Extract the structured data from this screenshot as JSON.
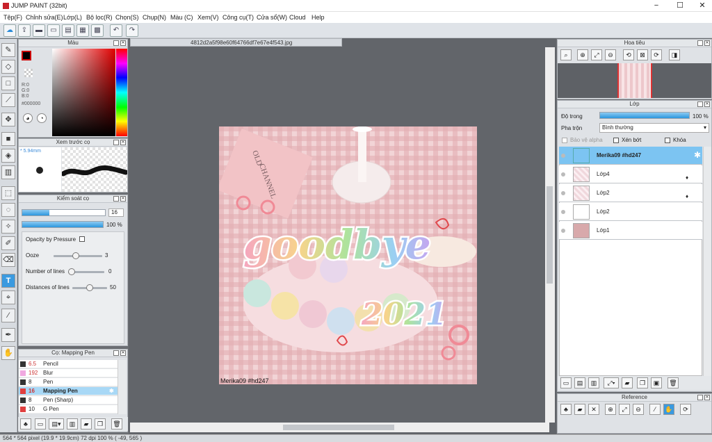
{
  "app": {
    "title": "JUMP PAINT (32bit)",
    "window_controls": [
      "−",
      "☐",
      "✕"
    ]
  },
  "menu": [
    "Tệp(F)",
    "Chỉnh sửa(E)",
    "Lớp(L)",
    "Bộ lọc(R)",
    "Chọn(S)",
    "Chụp(N)",
    "Màu (C)",
    "Xem(V)",
    "Công cụ(T)",
    "Cửa sổ(W)",
    "Cloud",
    "Help"
  ],
  "toolbar_icons": [
    "cloud-icon",
    "export-icon",
    "comment-icon",
    "message-icon",
    "page-icon",
    "layout-icon",
    "grid-icon",
    "undo-icon",
    "redo-icon"
  ],
  "color_panel": {
    "title": "Màu",
    "r": "R:0",
    "g": "G:0",
    "b": "B:0",
    "hex": "#000000"
  },
  "brush_preview": {
    "title": "Xem trước cọ",
    "size": "* 5.94mm"
  },
  "brush_control": {
    "title": "Kiểm soát cọ",
    "size": "16",
    "opacity": "100 %",
    "opacity_pct": 100,
    "opacity_by_pressure": "Opacity by Pressure",
    "rows": [
      {
        "label": "Ooze",
        "value": "3",
        "pos": 0.45
      },
      {
        "label": "Number of lines",
        "value": "0",
        "pos": 0.0
      },
      {
        "label": "Distances of lines",
        "value": "50",
        "pos": 0.5
      }
    ]
  },
  "brush_list": {
    "title": "Cọ: Mapping Pen",
    "items": [
      {
        "size": "6.5",
        "name": "Pencil",
        "color": "#333333"
      },
      {
        "size": "192",
        "name": "Blur",
        "color": "#f0a8e0"
      },
      {
        "size": "8",
        "name": "Pen",
        "color": "#333333"
      },
      {
        "size": "16",
        "name": "Mapping Pen",
        "color": "#e04040",
        "selected": true
      },
      {
        "size": "8",
        "name": "Pen (Sharp)",
        "color": "#333333"
      },
      {
        "size": "10",
        "name": "G Pen",
        "color": "#e04040"
      }
    ]
  },
  "document_tab": "4812d2a5f98e60f64766df7e67e4f543.jpg",
  "canvas": {
    "text1": "goodbye",
    "text2": "2021",
    "credit": "Merika09  #hd247",
    "book1": "CHANNEL",
    "book2": "OLD"
  },
  "navigator": {
    "title": "Hoa tiêu"
  },
  "layer_panel": {
    "title": "Lớp",
    "opacity_label": "Độ trong",
    "opacity": "100 %",
    "opacity_pct": 100,
    "blend_label": "Pha trộn",
    "blend": "Bình thường",
    "protect_alpha": "Bảo vệ alpha",
    "clipping": "Xén bớt",
    "lock": "Khóa",
    "layers": [
      {
        "name": "Merika09  #hd247",
        "selected": true
      },
      {
        "name": "Lớp4"
      },
      {
        "name": "Lớp2"
      },
      {
        "name": "Lớp2"
      },
      {
        "name": "Lớp1"
      }
    ]
  },
  "reference": {
    "title": "Reference"
  },
  "status": "564 * 564 pixel   (19.9 * 19.9cm)  72 dpi  100 %  ( -49, 565 )"
}
